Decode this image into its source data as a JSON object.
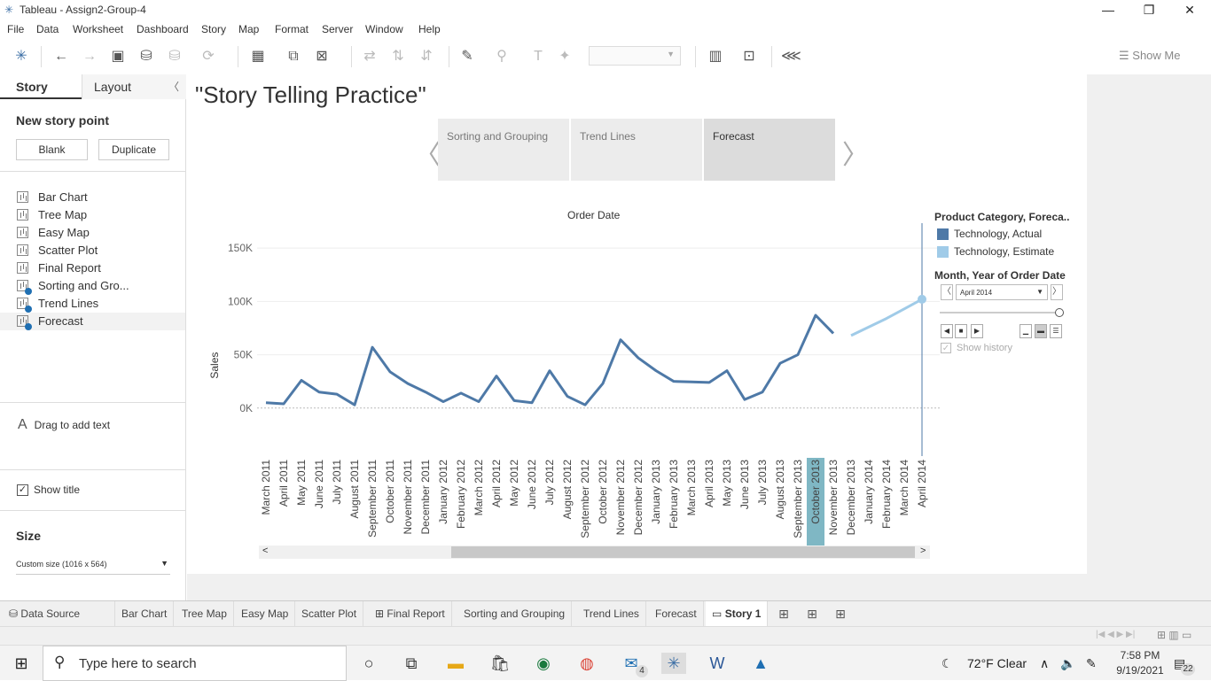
{
  "window": {
    "title": "Tableau - Assign2-Group-4"
  },
  "menu": [
    "File",
    "Data",
    "Worksheet",
    "Dashboard",
    "Story",
    "Map",
    "Format",
    "Server",
    "Window",
    "Help"
  ],
  "toolbar": {
    "show_me": "Show Me"
  },
  "left_pane": {
    "tab_story": "Story",
    "tab_layout": "Layout",
    "new_story_point": "New story point",
    "blank_button": "Blank",
    "duplicate_button": "Duplicate",
    "sheets": [
      "Bar Chart",
      "Tree Map",
      "Easy Map",
      "Scatter Plot",
      "Final Report",
      "Sorting and Gro...",
      "Trend Lines",
      "Forecast"
    ],
    "drag_text": "Drag to add text",
    "show_title": "Show title",
    "size_label": "Size",
    "size_value": "Custom size (1016 x 564)"
  },
  "story": {
    "title": "\"Story Telling Practice\"",
    "points": [
      "Sorting and Grouping",
      "Trend Lines",
      "Forecast"
    ],
    "active_point": "Forecast"
  },
  "legend": {
    "title": "Product Category, Foreca..",
    "items": [
      {
        "label": "Technology, Actual",
        "color": "#4e79a7"
      },
      {
        "label": "Technology, Estimate",
        "color": "#a0cbe8"
      }
    ],
    "page_title": "Month, Year of Order Date",
    "page_value": "April 2014",
    "show_history": "Show history"
  },
  "chart_data": {
    "type": "line",
    "title": "Order Date",
    "xlabel": "",
    "ylabel": "Sales",
    "ylim": [
      -45000,
      175000
    ],
    "yticks": [
      0,
      50000,
      100000,
      150000
    ],
    "ytick_labels": [
      "0K",
      "50K",
      "100K",
      "150K"
    ],
    "categories": [
      "March 2011",
      "April 2011",
      "May 2011",
      "June 2011",
      "July 2011",
      "August 2011",
      "September 2011",
      "October 2011",
      "November 2011",
      "December 2011",
      "January 2012",
      "February 2012",
      "March 2012",
      "April 2012",
      "May 2012",
      "June 2012",
      "July 2012",
      "August 2012",
      "September 2012",
      "October 2012",
      "November 2012",
      "December 2012",
      "January 2013",
      "February 2013",
      "March 2013",
      "April 2013",
      "May 2013",
      "June 2013",
      "July 2013",
      "August 2013",
      "September 2013",
      "October 2013",
      "November 2013",
      "December 2013",
      "January 2014",
      "February 2014",
      "March 2014",
      "April 2014"
    ],
    "highlighted_category": "October 2013",
    "series": [
      {
        "name": "Technology, Actual",
        "color": "#4e79a7",
        "values": [
          5000,
          4000,
          26000,
          15000,
          13000,
          3000,
          57000,
          34000,
          23000,
          15000,
          6000,
          14000,
          6000,
          30000,
          7000,
          5000,
          35000,
          11000,
          3000,
          23000,
          64000,
          47000,
          35000,
          25000,
          24500,
          24000,
          35000,
          8000,
          15000,
          42000,
          50000,
          87000,
          70000,
          null,
          null,
          null,
          null,
          null
        ]
      },
      {
        "name": "Technology, Estimate",
        "color": "#a0cbe8",
        "values": [
          null,
          null,
          null,
          null,
          null,
          null,
          null,
          null,
          null,
          null,
          null,
          null,
          null,
          null,
          null,
          null,
          null,
          null,
          null,
          null,
          null,
          null,
          null,
          null,
          null,
          null,
          null,
          null,
          null,
          null,
          null,
          null,
          null,
          68000,
          76000,
          84000,
          93000,
          102000
        ]
      }
    ]
  },
  "bottom_tabs": [
    "Data Source",
    "Bar Chart",
    "Tree Map",
    "Easy Map",
    "Scatter Plot",
    "Final Report",
    "Sorting and Grouping",
    "Trend Lines",
    "Forecast",
    "Story 1"
  ],
  "taskbar": {
    "search_placeholder": "Type here to search",
    "weather": "72°F  Clear",
    "time": "7:58 PM",
    "date": "9/19/2021",
    "mail_badge": "4",
    "notif_badge": "22"
  }
}
